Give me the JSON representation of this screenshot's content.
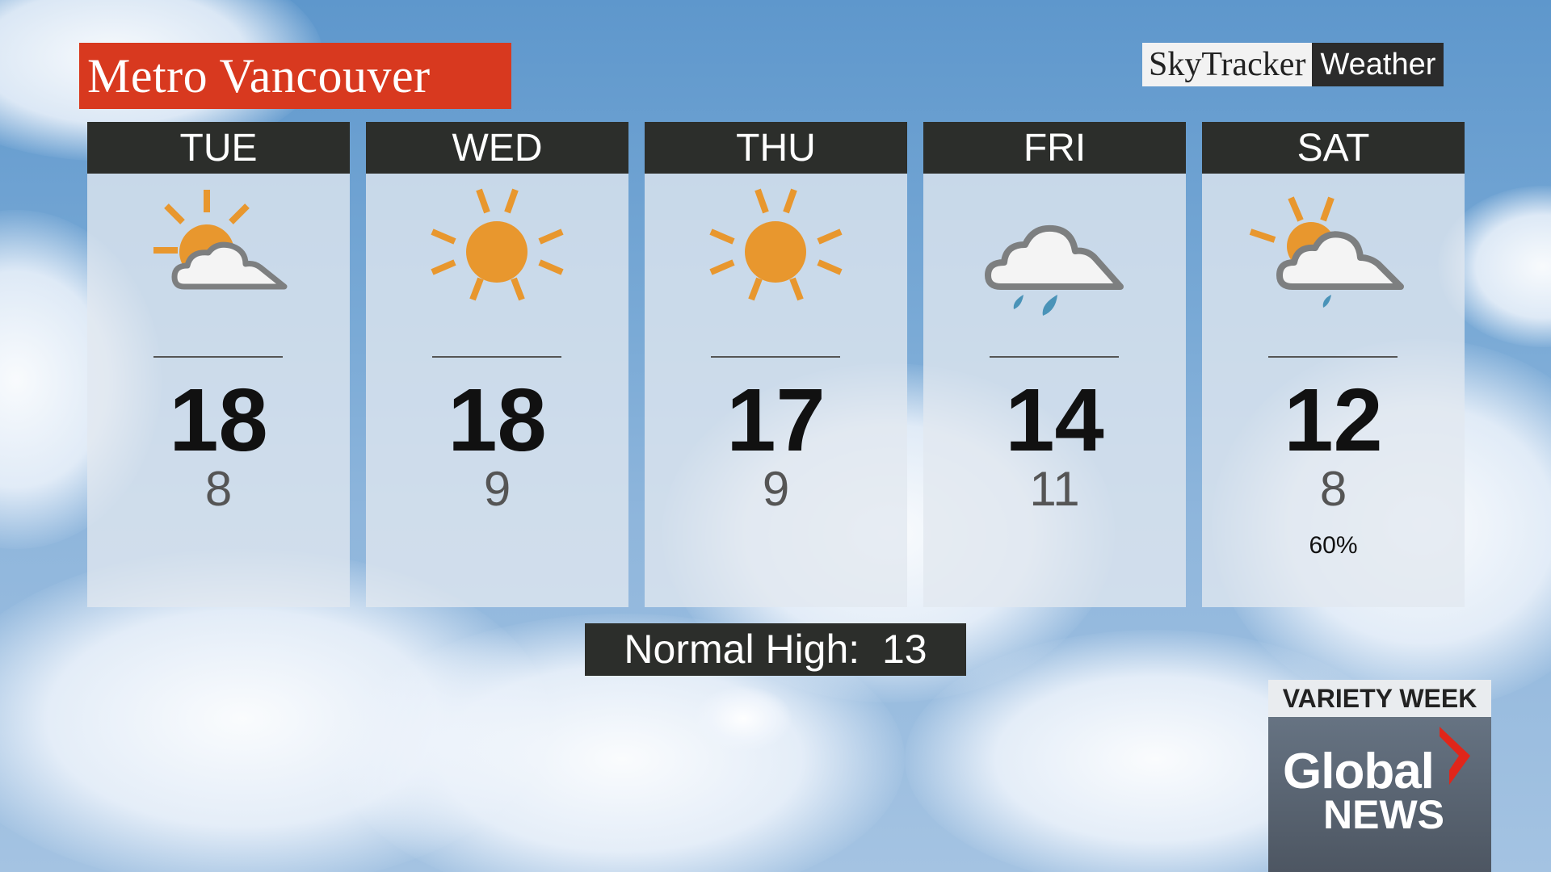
{
  "title": "Metro Vancouver",
  "logo": {
    "part1": "SkyTracker",
    "part2": "Weather"
  },
  "days": [
    {
      "day": "TUE",
      "icon": "sun-behind-cloud-icon",
      "high": "18",
      "low": "8",
      "pop": ""
    },
    {
      "day": "WED",
      "icon": "sun-icon",
      "high": "18",
      "low": "9",
      "pop": ""
    },
    {
      "day": "THU",
      "icon": "sun-icon",
      "high": "17",
      "low": "9",
      "pop": ""
    },
    {
      "day": "FRI",
      "icon": "cloud-rain-icon",
      "high": "14",
      "low": "11",
      "pop": ""
    },
    {
      "day": "SAT",
      "icon": "sun-cloud-rain-icon",
      "high": "12",
      "low": "8",
      "pop": "60%"
    }
  ],
  "normal": {
    "label": "Normal High:",
    "value": "13",
    "text": "Normal High:  13"
  },
  "brand": {
    "banner": "VARIETY WEEK",
    "line1": "Global",
    "line2": "NEWS"
  },
  "colors": {
    "title_bg": "#d8391f",
    "header_bg": "#2c2e2b",
    "sun": "#e8972e",
    "cloud": "#7d7f80",
    "rain": "#4a93b8"
  }
}
